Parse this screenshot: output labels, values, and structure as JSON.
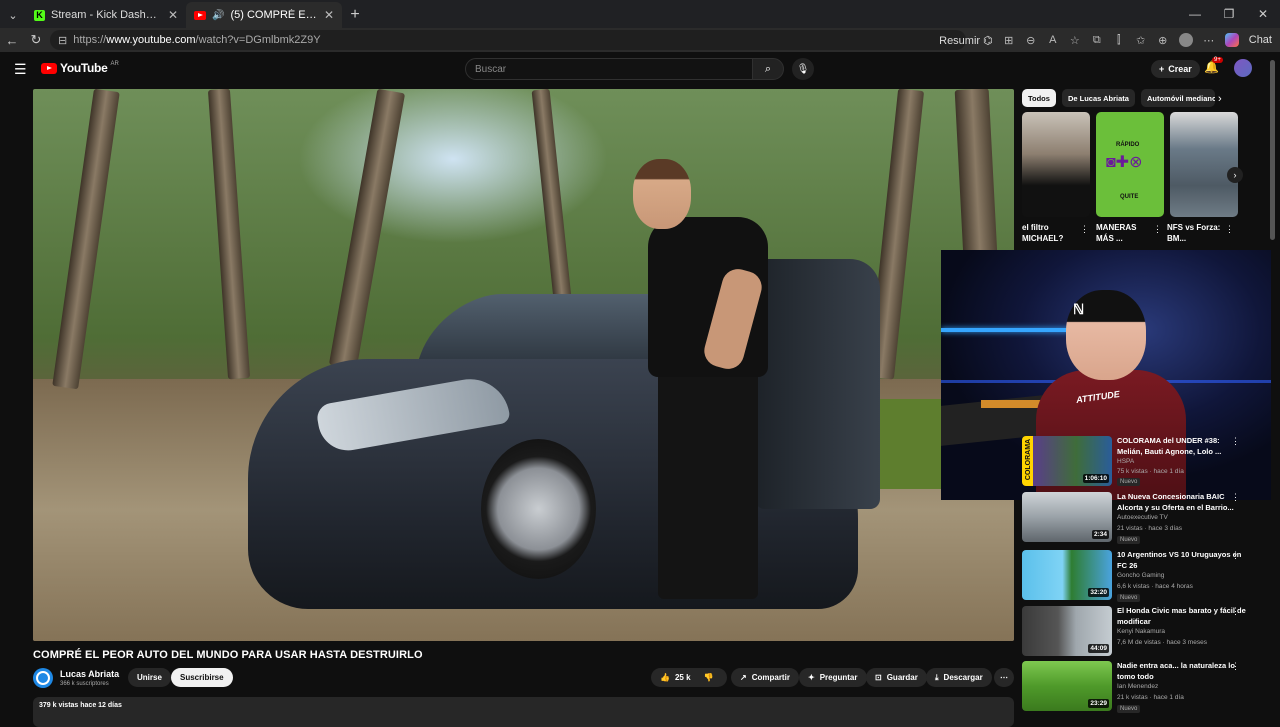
{
  "browser": {
    "tabs": [
      {
        "title": "Stream - Kick Dashboard",
        "active": false
      },
      {
        "title": "(5) COMPRÉ EL PEOR AUTO DEL MUNDO",
        "active": true
      }
    ],
    "url_prefix": "https://",
    "url_host": "www.youtube.com",
    "url_path": "/watch?v=DGmlbmk2Z9Y",
    "resumir_label": "Resumir",
    "chat_label": "Chat"
  },
  "header": {
    "logo_text": "YouTube",
    "logo_region": "AR",
    "search_placeholder": "Buscar",
    "create_label": "Crear",
    "notifications_count": "9+"
  },
  "video": {
    "title": "COMPRÉ EL PEOR AUTO DEL MUNDO PARA USAR HASTA DESTRUIRLO",
    "channel": "Lucas Abriata",
    "subscribers": "366 k suscriptores",
    "join_label": "Unirse",
    "subscribe_label": "Suscribirse",
    "likes": "25 k",
    "share_label": "Compartir",
    "ask_label": "Preguntar",
    "save_label": "Guardar",
    "download_label": "Descargar",
    "views_date": "379 k vistas  hace 12 días"
  },
  "webcam": {
    "shirt_text": "ATTITUDE"
  },
  "sidebar": {
    "chips": [
      "Todos",
      "De Lucas Abriata",
      "Automóvil mediano"
    ],
    "shorts": [
      {
        "title": "el filtro MICHAEL?",
        "thumb_text": ""
      },
      {
        "title": "MANERAS MÁS ...",
        "thumb_text": "RÁPIDO"
      },
      {
        "title": "NFS vs Forza: BM...",
        "thumb_text": ""
      }
    ],
    "shorts_thumb_text2": "QUITE",
    "recommendations": [
      {
        "title": "COLORAMA del UNDER #38: Melián, Bauti Agnone, Lolo ...",
        "channel": "HSPA",
        "meta": "75 k vistas · hace 1 día",
        "badge": "Nuevo",
        "duration": "1:06:10",
        "thumb_label": "COLORAMA"
      },
      {
        "title": "La Nueva Concesionaria BAIC Alcorta y su Oferta en el Barrio...",
        "channel": "Autoexecutive TV",
        "meta": "21 vistas · hace 3 días",
        "badge": "Nuevo",
        "duration": "2:34"
      },
      {
        "title": "10 Argentinos VS 10 Uruguayos en FC 26",
        "channel": "Goncho Gaming",
        "meta": "6,6 k vistas · hace 4 horas",
        "badge": "Nuevo",
        "duration": "32:20"
      },
      {
        "title": "El Honda Civic mas barato y fácil de modificar",
        "channel": "Kenyi Nakamura",
        "meta": "7,6 M de vistas · hace 3 meses",
        "badge": "",
        "duration": "44:09"
      },
      {
        "title": "Nadie entra aca... la naturaleza lo tomo todo",
        "channel": "Ian Menendez",
        "meta": "21 k vistas · hace 1 día",
        "badge": "Nuevo",
        "duration": "23:29"
      }
    ]
  }
}
